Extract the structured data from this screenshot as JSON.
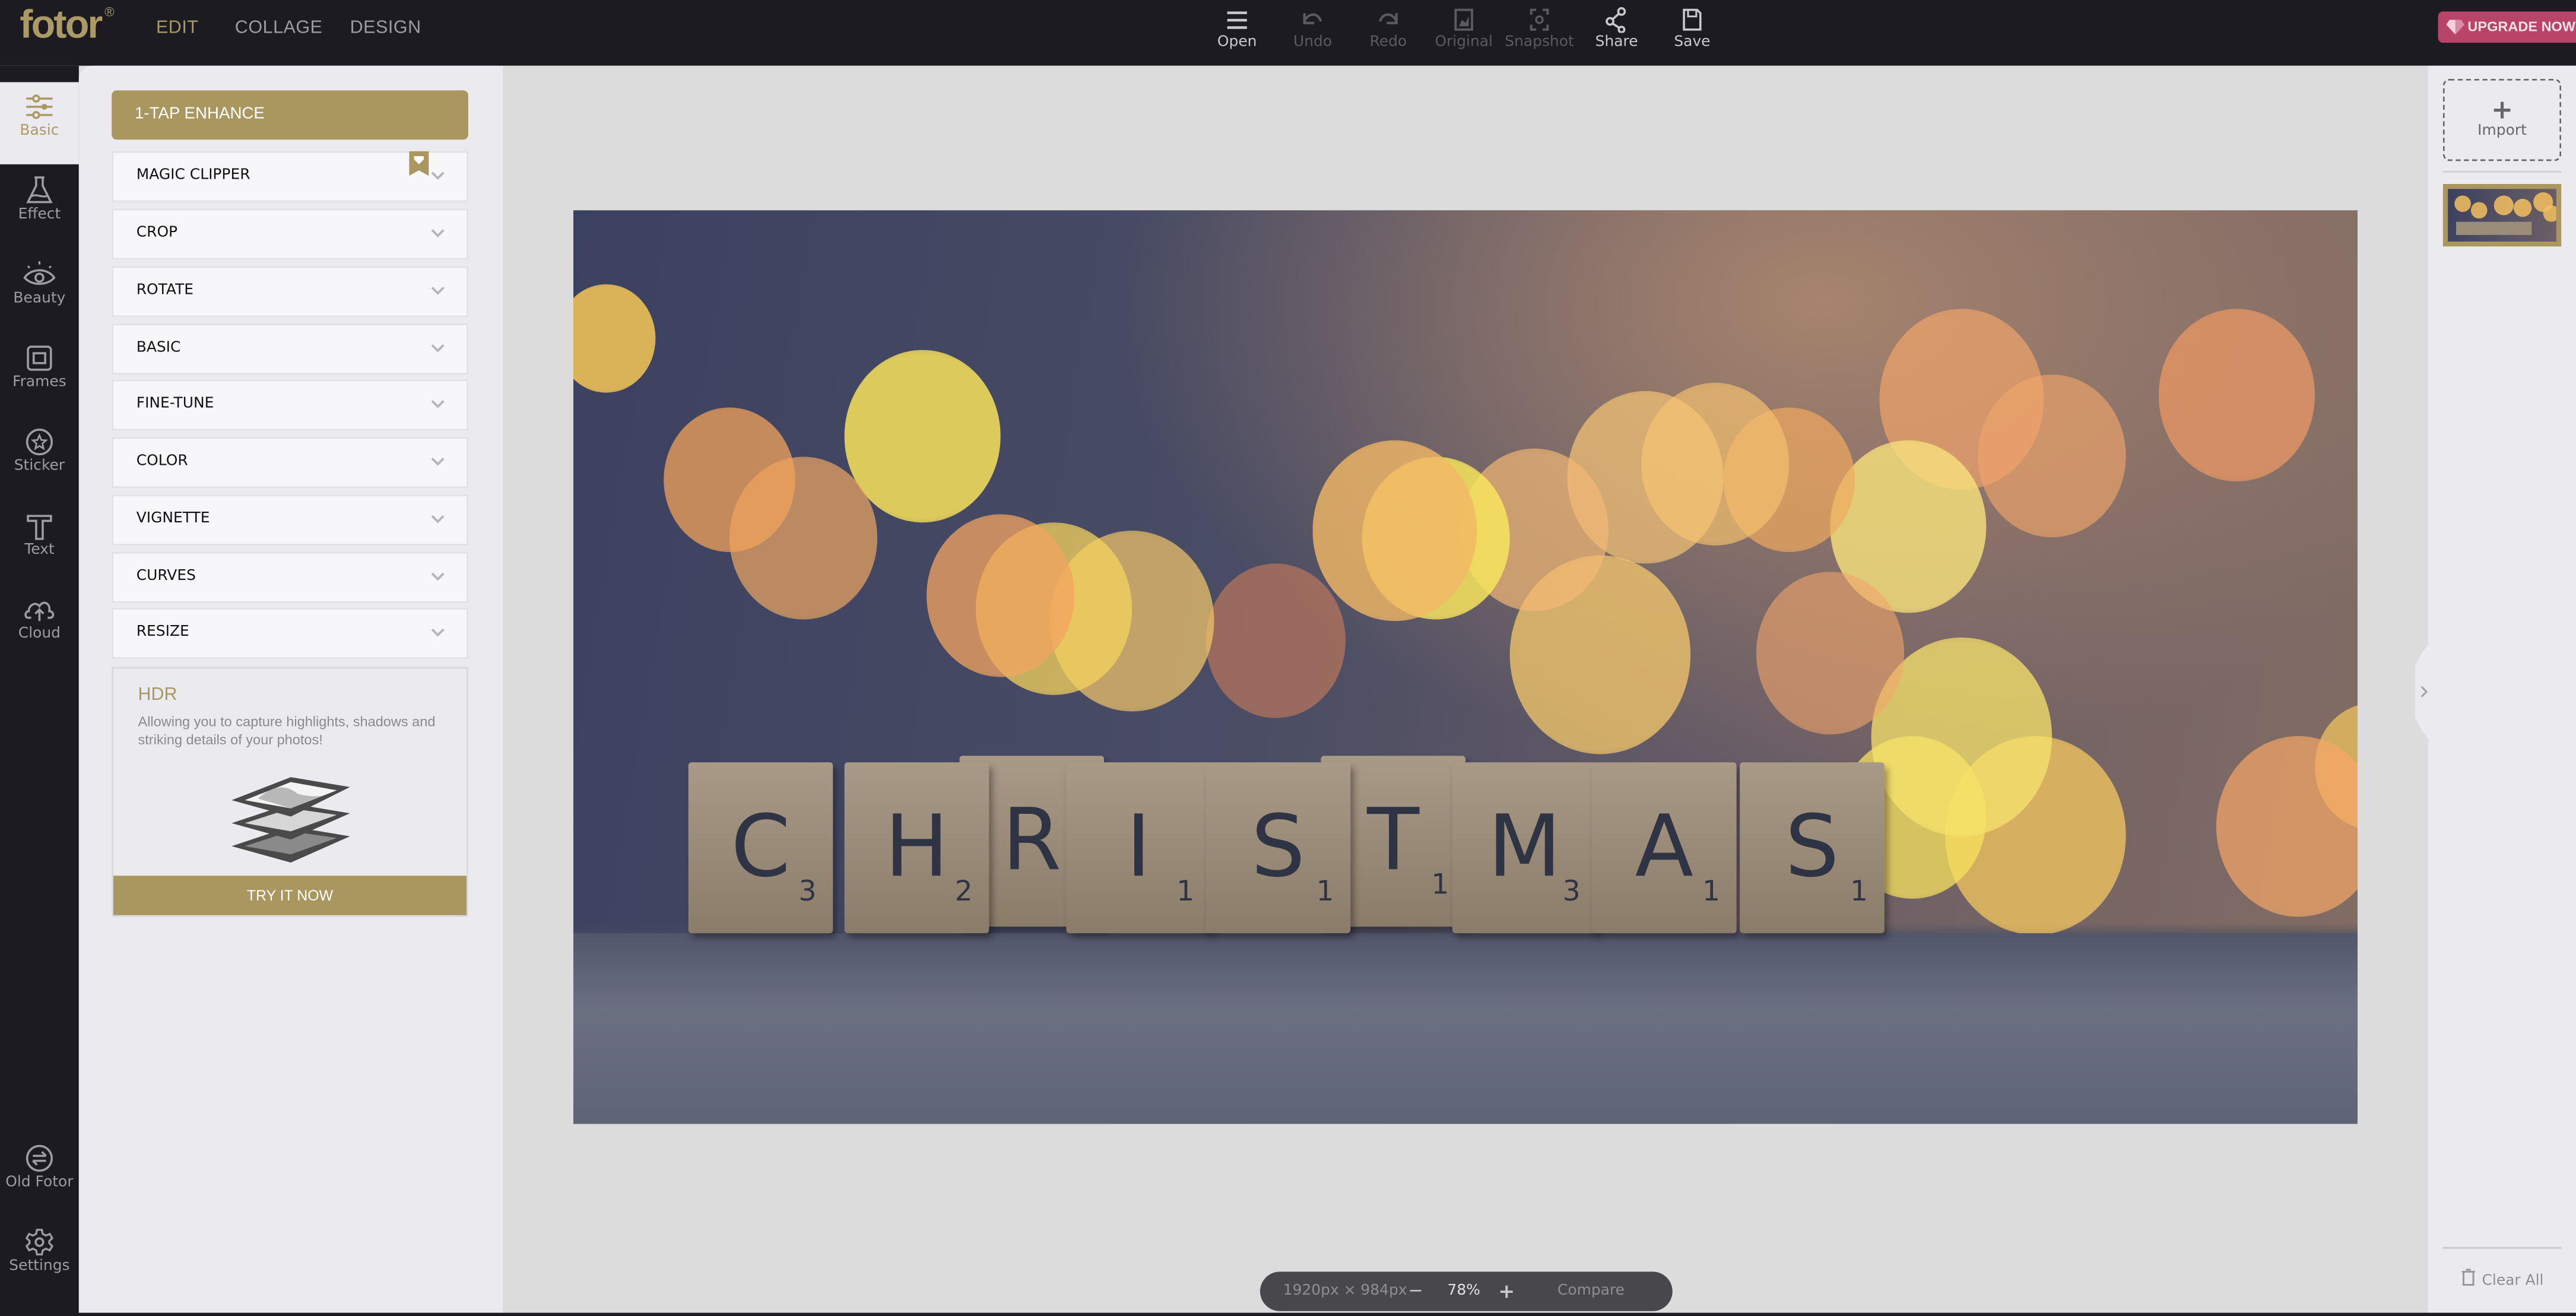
{
  "app": {
    "logo": "fotor",
    "logo_mark": "®",
    "nav": [
      "EDIT",
      "COLLAGE",
      "DESIGN"
    ],
    "active_nav": "EDIT",
    "accent_color": "#aa975f",
    "upgrade_color": "#b84469"
  },
  "toolbar": {
    "items": [
      {
        "label": "Open",
        "icon": "menu-icon",
        "enabled": true
      },
      {
        "label": "Undo",
        "icon": "undo-icon",
        "enabled": false
      },
      {
        "label": "Redo",
        "icon": "redo-icon",
        "enabled": false
      },
      {
        "label": "Original",
        "icon": "original-image-icon",
        "enabled": false
      },
      {
        "label": "Snapshot",
        "icon": "snapshot-icon",
        "enabled": false
      },
      {
        "label": "Share",
        "icon": "share-icon",
        "enabled": true
      },
      {
        "label": "Save",
        "icon": "save-icon",
        "enabled": true
      }
    ],
    "upgrade_label": "UPGRADE NOW"
  },
  "sidebar": {
    "items": [
      {
        "label": "Basic",
        "icon": "sliders-icon",
        "active": true
      },
      {
        "label": "Effect",
        "icon": "flask-icon"
      },
      {
        "label": "Beauty",
        "icon": "eye-icon"
      },
      {
        "label": "Frames",
        "icon": "frame-icon"
      },
      {
        "label": "Sticker",
        "icon": "star-circle-icon"
      },
      {
        "label": "Text",
        "icon": "text-icon"
      },
      {
        "label": "Cloud",
        "icon": "cloud-upload-icon"
      }
    ],
    "bottom_items": [
      {
        "label": "Old Fotor",
        "icon": "switch-icon"
      },
      {
        "label": "Settings",
        "icon": "gear-icon"
      }
    ]
  },
  "panel": {
    "enhance_label": "1-TAP ENHANCE",
    "sections": [
      {
        "label": "MAGIC CLIPPER",
        "premium": true
      },
      {
        "label": "CROP"
      },
      {
        "label": "ROTATE"
      },
      {
        "label": "BASIC"
      },
      {
        "label": "FINE-TUNE"
      },
      {
        "label": "COLOR"
      },
      {
        "label": "VIGNETTE"
      },
      {
        "label": "CURVES"
      },
      {
        "label": "RESIZE"
      }
    ],
    "promo": {
      "title": "HDR",
      "description": "Allowing you to capture highlights, shadows and striking details of your photos!",
      "button": "TRY IT NOW"
    }
  },
  "canvas": {
    "tiles": [
      {
        "letter": "C",
        "score": "3"
      },
      {
        "letter": "H",
        "score": "2"
      },
      {
        "letter": "R",
        "score": ""
      },
      {
        "letter": "I",
        "score": "1"
      },
      {
        "letter": "S",
        "score": "1"
      },
      {
        "letter": "T",
        "score": "1"
      },
      {
        "letter": "M",
        "score": "3"
      },
      {
        "letter": "A",
        "score": "1"
      },
      {
        "letter": "S",
        "score": "1"
      }
    ]
  },
  "zoombar": {
    "dimensions": "1920px × 984px",
    "zoom_out": "−",
    "zoom_level": "78%",
    "zoom_in": "+",
    "compare": "Compare"
  },
  "rightbar": {
    "import_icon": "+",
    "import_label": "Import",
    "clear_all": "Clear All"
  }
}
